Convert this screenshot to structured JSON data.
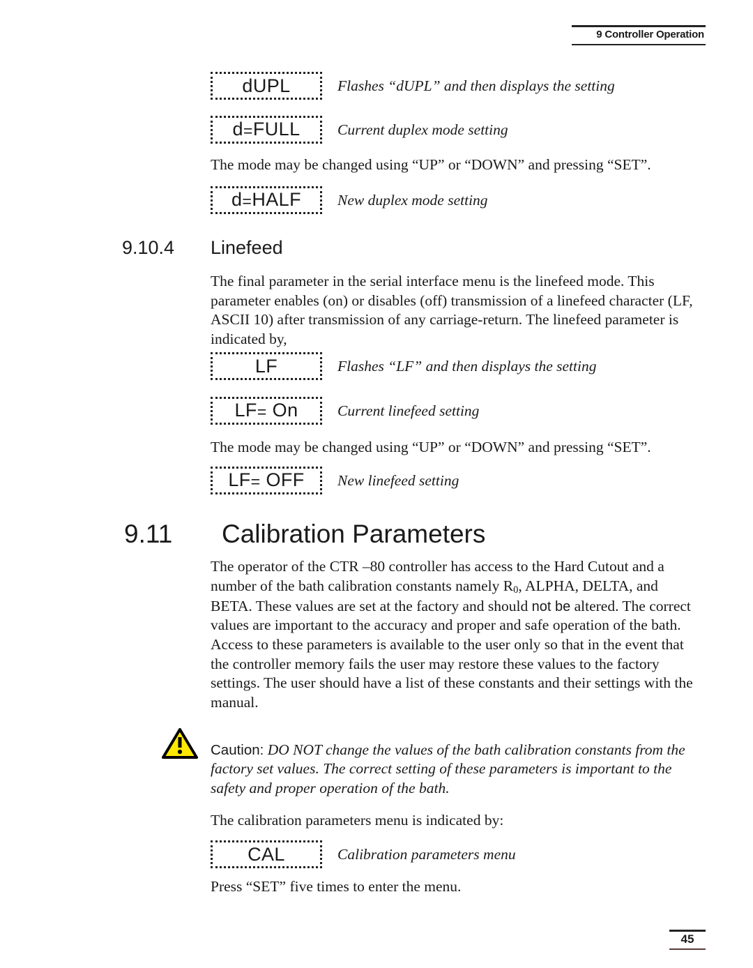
{
  "header": {
    "running_head": "9 Controller Operation"
  },
  "footer": {
    "page_number": "45"
  },
  "displays": {
    "dupl": {
      "text": "dUPL",
      "caption": "Flashes “dUPL” and then displays the setting"
    },
    "dfull": {
      "pre": "d",
      "eq": "=",
      "post": "FULL",
      "caption": "Current duplex mode setting"
    },
    "dhalf": {
      "pre": "d",
      "eq": "=",
      "post": "HALF",
      "caption": "New duplex mode setting"
    },
    "lf": {
      "text": "LF",
      "caption": "Flashes “LF” and then displays the setting"
    },
    "lf_on": {
      "pre": "LF",
      "eq": "=",
      "post": " On",
      "caption": "Current linefeed setting"
    },
    "lf_off": {
      "pre": "LF",
      "eq": "=",
      "post": " OFF",
      "caption": "New linefeed setting"
    },
    "cal": {
      "text": "CAL",
      "caption": "Calibration parameters menu"
    }
  },
  "paragraphs": {
    "mode_change_duplex": "The mode may be changed using “UP” or “DOWN” and pressing “SET”.",
    "mode_change_linefeed": "The mode may be changed using “UP” or “DOWN” and pressing “SET”.",
    "linefeed_intro": "The final parameter in the serial interface menu is the linefeed mode. This parameter enables (on) or disables (off) transmission of a linefeed character (LF, ASCII 10) after transmission of any carriage-return. The linefeed parameter is indicated by,",
    "calibration_intro_a": "The operator of the CTR –80 controller has access to the Hard Cutout and a number of the bath calibration constants namely R",
    "calibration_sub": "0",
    "calibration_intro_b": ", ALPHA, DELTA, and BETA. These values are set at the factory and should ",
    "calibration_emph": "not be",
    "calibration_intro_c": " altered. The correct values are important to the accuracy and proper and safe operation of the bath. Access to these parameters is available to the user only so that in the event that the controller memory fails the user may restore these values to the factory settings. The user should have a list of these constants and their settings with the manual.",
    "cal_menu_indicated": "The calibration parameters menu is indicated by:",
    "press_set": "Press “SET” five times to enter the menu."
  },
  "caution": {
    "label": "Caution:",
    "text": " DO NOT change the values of the bath calibration constants from the factory set values. The correct setting of these parameters is important to the safety and proper operation of the bath.",
    "icon_fill": "#FFE800",
    "icon_stroke": "#000000"
  },
  "headings": {
    "linefeed": {
      "number": "9.10.4",
      "title": "Linefeed"
    },
    "calibration": {
      "number": "9.11",
      "title": "Calibration Parameters"
    }
  }
}
